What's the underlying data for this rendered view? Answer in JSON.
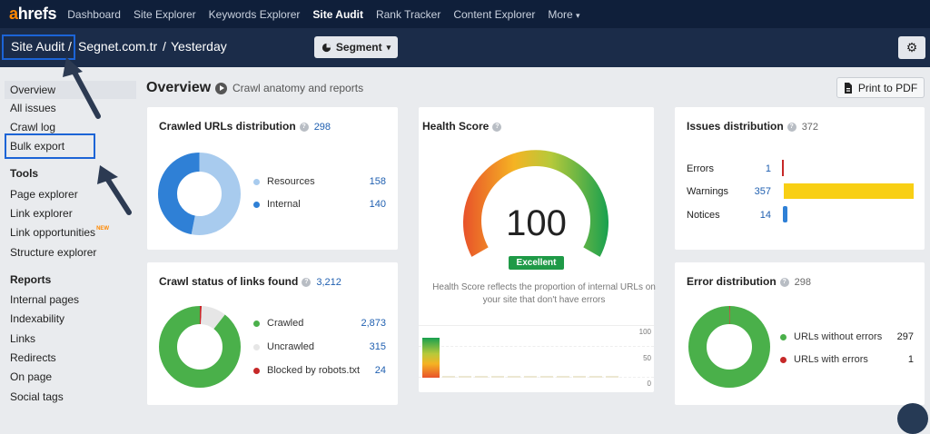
{
  "nav": {
    "logo_a": "a",
    "logo_rest": "hrefs",
    "items": [
      "Dashboard",
      "Site Explorer",
      "Keywords Explorer",
      "Site Audit",
      "Rank Tracker",
      "Content Explorer",
      "More"
    ],
    "more_caret": "▾"
  },
  "breadcrumb": {
    "part1": "Site Audit",
    "sep1": "/",
    "project": "Segnet.com.tr",
    "sep2": "/",
    "date": "Yesterday"
  },
  "segment": {
    "label": "Segment",
    "caret": "▾"
  },
  "sidebar": {
    "top_items": [
      "Overview",
      "All issues",
      "Crawl log",
      "Bulk export"
    ],
    "tools_heading": "Tools",
    "tools": [
      "Page explorer",
      "Link explorer",
      "Link opportunities",
      "Structure explorer"
    ],
    "new_tag": "NEW",
    "reports_heading": "Reports",
    "reports": [
      "Internal pages",
      "Indexability",
      "Links",
      "Redirects",
      "On page",
      "Social tags"
    ]
  },
  "page": {
    "title": "Overview",
    "subtitle": "Crawl anatomy and reports",
    "print_label": "Print to PDF"
  },
  "crawled_urls": {
    "title": "Crawled URLs distribution",
    "total": "298",
    "legend": [
      {
        "label": "Resources",
        "value": "158"
      },
      {
        "label": "Internal",
        "value": "140"
      }
    ]
  },
  "health": {
    "title": "Health Score",
    "score": "100",
    "badge": "Excellent",
    "description": "Health Score reflects the proportion of internal URLs on your site that don't have errors",
    "axis": [
      "100",
      "50",
      "0"
    ],
    "value_fraction": 1.0
  },
  "issues": {
    "title": "Issues distribution",
    "total": "372",
    "rows": [
      {
        "label": "Errors",
        "value": "1"
      },
      {
        "label": "Warnings",
        "value": "357"
      },
      {
        "label": "Notices",
        "value": "14"
      }
    ]
  },
  "crawl_status": {
    "title": "Crawl status of links found",
    "total": "3,212",
    "legend": [
      {
        "label": "Crawled",
        "value": "2,873"
      },
      {
        "label": "Uncrawled",
        "value": "315"
      },
      {
        "label": "Blocked by robots.txt",
        "value": "24"
      }
    ]
  },
  "error_dist": {
    "title": "Error distribution",
    "total": "298",
    "legend": [
      {
        "label": "URLs without errors",
        "value": "297"
      },
      {
        "label": "URLs with errors",
        "value": "1"
      }
    ]
  },
  "colors": {
    "light_blue": "#a8cbee",
    "blue": "#2f80d6",
    "green": "#4ab04a",
    "light_gray": "#e6e6e6",
    "red": "#c62828",
    "yellow": "#f8cf14",
    "accent_blue": "#1c64d6",
    "navy": "#0f1f3a"
  },
  "icons": {
    "print": "print-icon",
    "gear": "gear-icon",
    "segment": "pie-icon",
    "help": "help-icon",
    "play": "play-icon"
  }
}
